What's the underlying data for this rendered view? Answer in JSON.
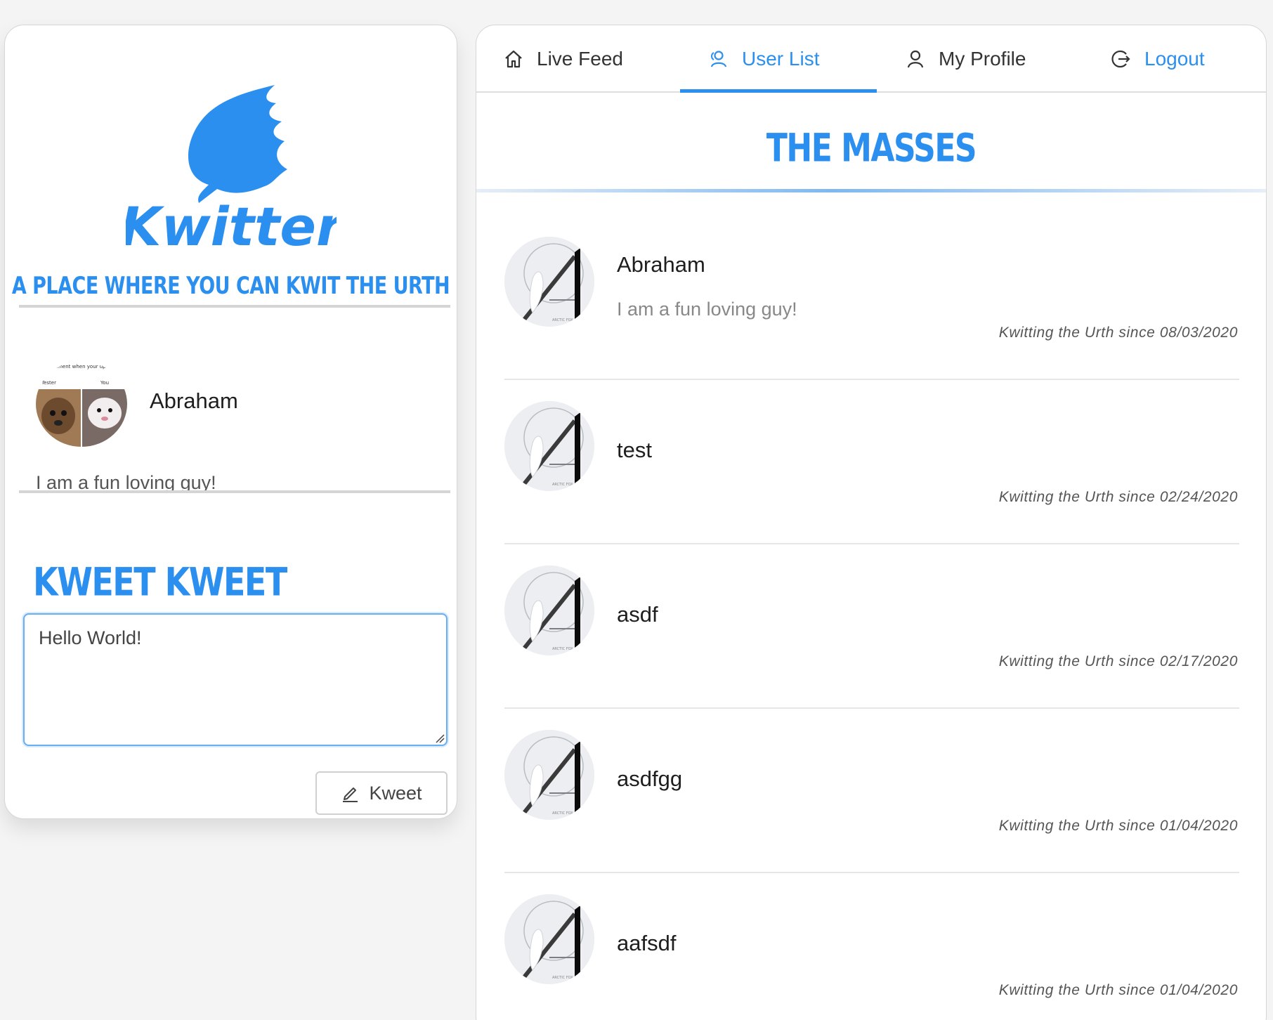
{
  "brand": {
    "name": "Kwitter",
    "tagline": "A PLACE WHERE YOU CAN KWIT THE URTH",
    "color": "#2b8ff0"
  },
  "me": {
    "name": "Abraham",
    "bio": "I am a fun loving guy!",
    "avatar_caption_top": "...ument when your up... ...es in production.",
    "avatar_label_left": "Tester",
    "avatar_label_right": "You"
  },
  "compose": {
    "title": "KWEET KWEET",
    "value": "Hello World!",
    "button_label": "Kweet",
    "button_icon": "pencil-icon"
  },
  "nav": {
    "items": [
      {
        "label": "Live Feed",
        "icon": "home-icon"
      },
      {
        "label": "User List",
        "icon": "users-icon"
      },
      {
        "label": "My Profile",
        "icon": "user-icon"
      },
      {
        "label": "Logout",
        "icon": "logout-icon"
      }
    ],
    "active": "User List"
  },
  "masses": {
    "title": "THE MASSES",
    "users": [
      {
        "name": "Abraham",
        "bio": "I am a fun loving guy!",
        "since": "Kwitting the Urth since 08/03/2020"
      },
      {
        "name": "test",
        "bio": "",
        "since": "Kwitting the Urth since 02/24/2020"
      },
      {
        "name": "asdf",
        "bio": "",
        "since": "Kwitting the Urth since 02/17/2020"
      },
      {
        "name": "asdfgg",
        "bio": "",
        "since": "Kwitting the Urth since 01/04/2020"
      },
      {
        "name": "aafsdf",
        "bio": "",
        "since": "Kwitting the Urth since 01/04/2020"
      }
    ],
    "avatar_caption": "ARCTIC FOX"
  }
}
